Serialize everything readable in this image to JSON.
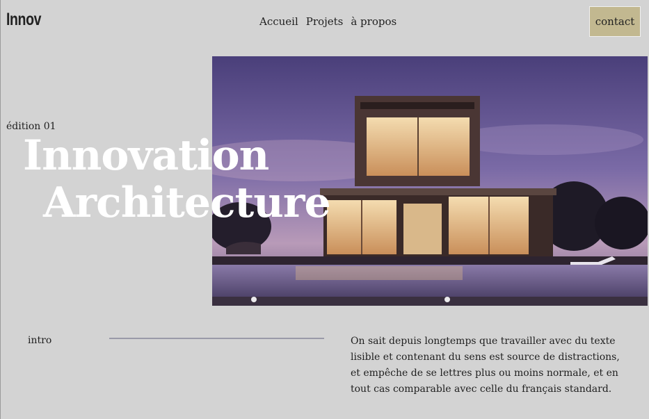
{
  "brand": {
    "logo": "Innov"
  },
  "nav": {
    "items": [
      {
        "label": "Accueil"
      },
      {
        "label": "Projets"
      },
      {
        "label": "à propos"
      }
    ],
    "contact_label": "contact"
  },
  "hero": {
    "edition": "édition 01",
    "title_line1": "Innovation",
    "title_line2": "Architecture",
    "image_subject": "modern-house-at-dusk"
  },
  "intro": {
    "label": "intro",
    "text": "On sait depuis longtemps que travailler avec du texte lisible et contenant du sens est source de distractions, et empêche de se lettres plus ou moins normale, et en tout cas comparable avec celle du français standard."
  },
  "colors": {
    "background": "#d3d3d3",
    "contact_button": "#c2b890",
    "divider": "#9a9aa8",
    "hero_title": "#ffffff"
  }
}
